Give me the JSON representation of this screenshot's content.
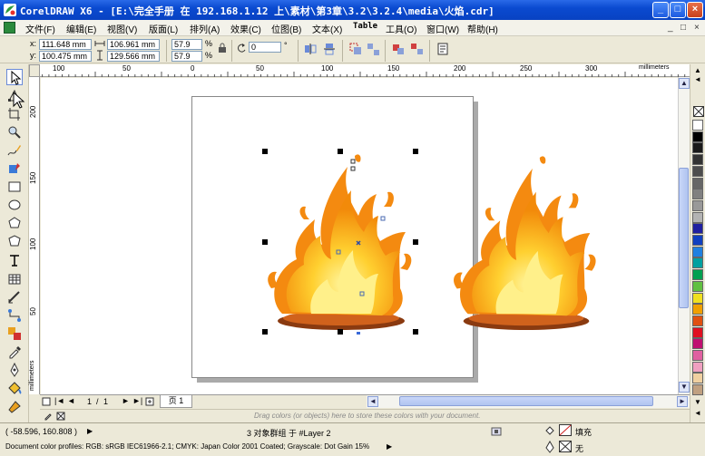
{
  "window": {
    "title": "CorelDRAW X6 - [E:\\完全手册 在 192.168.1.12 上\\素材\\第3章\\3.2\\3.2.4\\media\\火焰.cdr]",
    "minimize_glyph": "_",
    "maximize_glyph": "□",
    "close_glyph": "×"
  },
  "menu": {
    "items": [
      "文件(F)",
      "编辑(E)",
      "视图(V)",
      "版面(L)",
      "排列(A)",
      "效果(C)",
      "位图(B)",
      "文本(X)",
      "Table",
      "工具(O)",
      "窗口(W)",
      "帮助(H)"
    ],
    "mdi_controls": [
      "_",
      "□",
      "×"
    ]
  },
  "property_bar": {
    "x_label": "x:",
    "x_value": "111.648 mm",
    "y_label": "y:",
    "y_value": "100.475 mm",
    "width_value": "106.961 mm",
    "height_value": "129.566 mm",
    "scale_x": "57.9",
    "scale_y": "57.9",
    "percent_symbol": "%",
    "rotation_value": "0",
    "degree_symbol": "°"
  },
  "rulers": {
    "unit": "millimeters",
    "h_ticks": [
      "100",
      "50",
      "0",
      "50",
      "100",
      "150",
      "200",
      "250",
      "300"
    ],
    "v_ticks": [
      "200",
      "150",
      "100",
      "50"
    ]
  },
  "page_nav": {
    "current": "1",
    "of": "/",
    "total": "1",
    "tab_label": "页 1"
  },
  "docker": {
    "hint": "Drag colors (or objects) here to store these colors with your document."
  },
  "status": {
    "cursor_position": "( -58.596, 160.808 )",
    "selection_info": "3 对象群组 于 #Layer 2",
    "color_profiles": "Document color profiles: RGB: sRGB IEC61966-2.1; CMYK: Japan Color 2001 Coated; Grayscale: Dot Gain 15%",
    "fill_label": "填充",
    "outline_label": "无"
  },
  "palette": {
    "colors": [
      "#ffffff",
      "#000000",
      "#1a1a1a",
      "#333333",
      "#4d4d4d",
      "#666666",
      "#808080",
      "#999999",
      "#b3b3b3",
      "#2020a0",
      "#1040c0",
      "#2080e0",
      "#00a0a0",
      "#00a050",
      "#60c040",
      "#f0e020",
      "#f0a000",
      "#e05010",
      "#e01020",
      "#c01070",
      "#e060a0",
      "#f0a0c0",
      "#f0d0a0",
      "#c0a080"
    ]
  },
  "theme": {
    "accent": "#0a4ad0",
    "selection_handle": "#000000",
    "flame_outer": "#f59a0c",
    "flame_inner": "#ffd23a",
    "flame_core": "#fff08a",
    "ember": "#c0521a"
  }
}
